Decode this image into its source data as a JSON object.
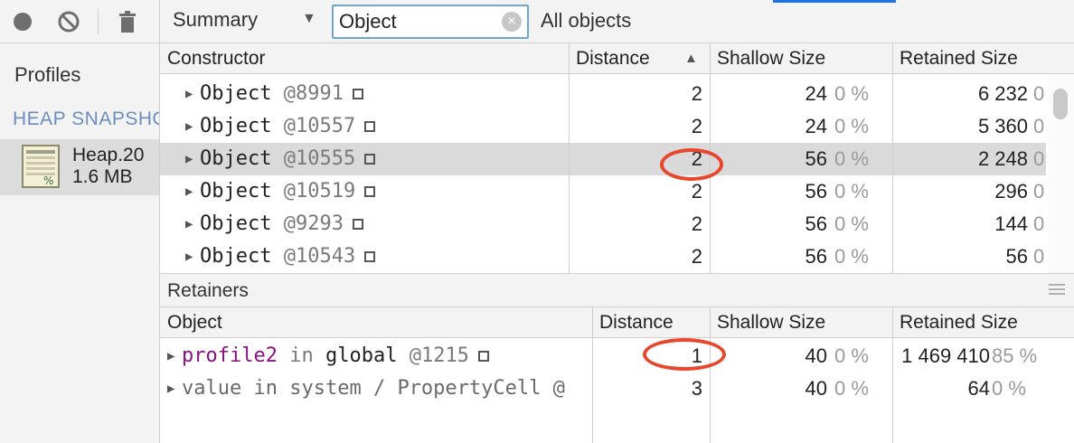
{
  "toolbar": {
    "record_icon": "record-icon",
    "clear_icon": "clear-icon",
    "delete_icon": "trash-icon"
  },
  "sidebar": {
    "title": "Profiles",
    "section": "HEAP SNAPSHOTS",
    "snapshot": {
      "name": "Heap.20",
      "size": "1.6 MB"
    }
  },
  "main_toolbar": {
    "view": "Summary",
    "filter_value": "Object",
    "class_filter": "All objects"
  },
  "summary_grid": {
    "columns": [
      "Constructor",
      "Distance",
      "Shallow Size",
      "Retained Size"
    ],
    "sort_indicator": "▲",
    "rows": [
      {
        "name": "Object",
        "id": "@8991",
        "distance": "2",
        "shallow": "24",
        "shallow_pct": "0 %",
        "retained": "6 232",
        "retained_pct": "0"
      },
      {
        "name": "Object",
        "id": "@10557",
        "distance": "2",
        "shallow": "24",
        "shallow_pct": "0 %",
        "retained": "5 360",
        "retained_pct": "0"
      },
      {
        "name": "Object",
        "id": "@10555",
        "distance": "2",
        "shallow": "56",
        "shallow_pct": "0 %",
        "retained": "2 248",
        "retained_pct": "0",
        "selected": true
      },
      {
        "name": "Object",
        "id": "@10519",
        "distance": "2",
        "shallow": "56",
        "shallow_pct": "0 %",
        "retained": "296",
        "retained_pct": "0"
      },
      {
        "name": "Object",
        "id": "@9293",
        "distance": "2",
        "shallow": "56",
        "shallow_pct": "0 %",
        "retained": "144",
        "retained_pct": "0"
      },
      {
        "name": "Object",
        "id": "@10543",
        "distance": "2",
        "shallow": "56",
        "shallow_pct": "0 %",
        "retained": "56",
        "retained_pct": "0"
      }
    ]
  },
  "retainers": {
    "title": "Retainers",
    "columns": [
      "Object",
      "Distance",
      "Shallow Size",
      "Retained Size"
    ],
    "rows": [
      {
        "prop": "profile2",
        "connector": "in",
        "target": "global",
        "id": "@1215",
        "distance": "1",
        "shallow": "40",
        "shallow_pct": "0 %",
        "retained": "1 469 410",
        "retained_pct": "85 %"
      },
      {
        "prop": "value",
        "connector": "in",
        "target": "system / PropertyCell",
        "id": "@",
        "distance": "3",
        "shallow": "40",
        "shallow_pct": "0 %",
        "retained": "64",
        "retained_pct": "0 %"
      }
    ]
  },
  "colors": {
    "annotation": "#e8472e",
    "accent": "#1a73e8",
    "property": "#881280"
  }
}
